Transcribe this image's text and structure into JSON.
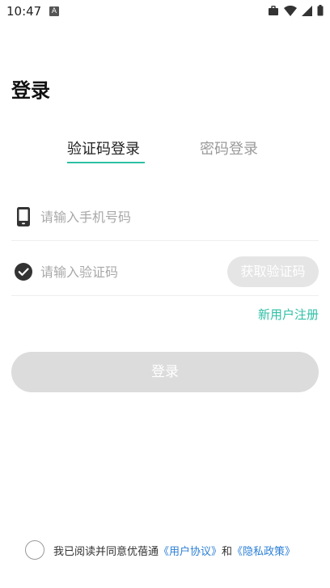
{
  "status_bar": {
    "time": "10:47",
    "notification_badge": "A",
    "icons": [
      "briefcase-icon",
      "wifi-icon",
      "signal-icon",
      "battery-icon"
    ]
  },
  "page": {
    "title": "登录"
  },
  "tabs": [
    {
      "label": "验证码登录",
      "active": true
    },
    {
      "label": "密码登录",
      "active": false
    }
  ],
  "form": {
    "phone_placeholder": "请输入手机号码",
    "code_placeholder": "请输入验证码",
    "get_code_label": "获取验证码",
    "register_label": "新用户注册",
    "login_label": "登录"
  },
  "agreement": {
    "prefix": "我已阅读并同意优蓓通",
    "user_agreement": "《用户协议》",
    "and": "和",
    "privacy_policy": "《隐私政策》"
  },
  "colors": {
    "accent": "#2ebfa5",
    "link": "#2b7fd6",
    "disabled_button": "#dcdcdc"
  }
}
